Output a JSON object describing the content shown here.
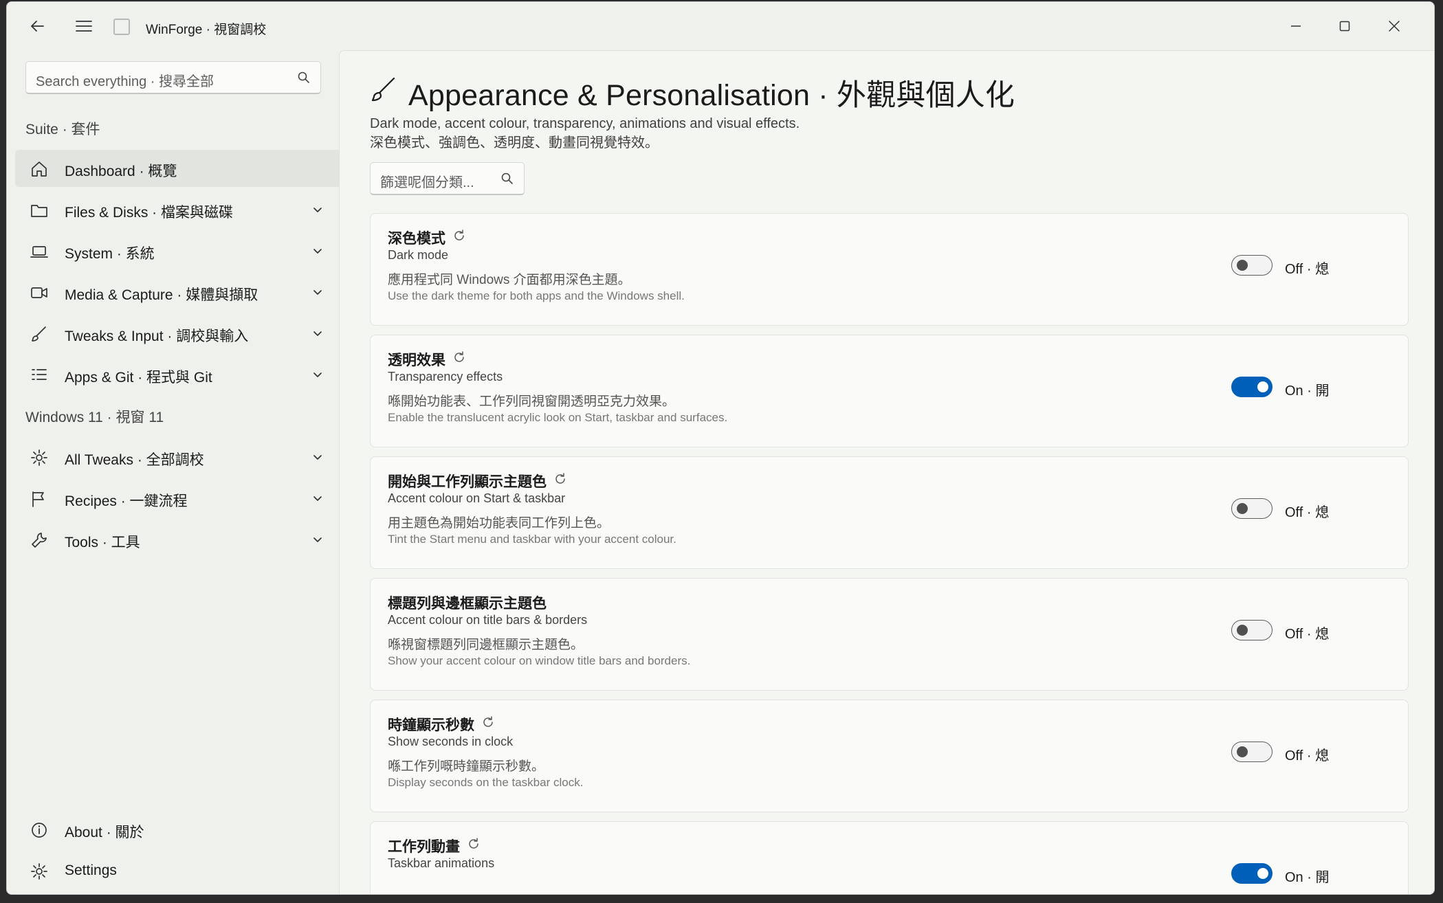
{
  "app": {
    "title": "WinForge · 視窗調校"
  },
  "sidebar": {
    "search_placeholder": "Search everything · 搜尋全部",
    "sections": {
      "suite": "Suite · 套件",
      "windows11": "Windows 11 · 視窗 11"
    },
    "items": [
      {
        "label": "Dashboard · 概覽",
        "icon": "home-icon"
      },
      {
        "label": "Files & Disks · 檔案與磁碟",
        "icon": "folder-icon"
      },
      {
        "label": "System · 系統",
        "icon": "laptop-icon"
      },
      {
        "label": "Media & Capture · 媒體與擷取",
        "icon": "camera-icon"
      },
      {
        "label": "Tweaks & Input · 調校與輸入",
        "icon": "brush-icon"
      },
      {
        "label": "Apps & Git · 程式與 Git",
        "icon": "list-icon"
      },
      {
        "label": "All Tweaks · 全部調校",
        "icon": "gear-icon"
      },
      {
        "label": "Recipes · 一鍵流程",
        "icon": "flag-icon"
      },
      {
        "label": "Tools · 工具",
        "icon": "wrench-icon"
      }
    ],
    "footer": [
      {
        "label": "About · 關於",
        "icon": "info-icon"
      },
      {
        "label": "Settings",
        "icon": "gear-icon"
      }
    ]
  },
  "page": {
    "title": "Appearance & Personalisation · 外觀與個人化",
    "desc_en": "Dark mode, accent colour, transparency, animations and visual effects.",
    "desc_zh": "深色模式、強調色、透明度、動畫同視覺特效。",
    "filter_placeholder": "篩選呢個分類..."
  },
  "settings": [
    {
      "title": "深色模式",
      "subtitle": "Dark mode",
      "desc_zh": "應用程式同 Windows 介面都用深色主題。",
      "desc_en": "Use the dark theme for both apps and the Windows shell.",
      "on": false,
      "state": "Off · 熄",
      "reset": true
    },
    {
      "title": "透明效果",
      "subtitle": "Transparency effects",
      "desc_zh": "喺開始功能表、工作列同視窗開透明亞克力效果。",
      "desc_en": "Enable the translucent acrylic look on Start, taskbar and surfaces.",
      "on": true,
      "state": "On · 開",
      "reset": true
    },
    {
      "title": "開始與工作列顯示主題色",
      "subtitle": "Accent colour on Start & taskbar",
      "desc_zh": "用主題色為開始功能表同工作列上色。",
      "desc_en": "Tint the Start menu and taskbar with your accent colour.",
      "on": false,
      "state": "Off · 熄",
      "reset": true
    },
    {
      "title": "標題列與邊框顯示主題色",
      "subtitle": "Accent colour on title bars & borders",
      "desc_zh": "喺視窗標題列同邊框顯示主題色。",
      "desc_en": "Show your accent colour on window title bars and borders.",
      "on": false,
      "state": "Off · 熄",
      "reset": false
    },
    {
      "title": "時鐘顯示秒數",
      "subtitle": "Show seconds in clock",
      "desc_zh": "喺工作列嘅時鐘顯示秒數。",
      "desc_en": "Display seconds on the taskbar clock.",
      "on": false,
      "state": "Off · 熄",
      "reset": true
    },
    {
      "title": "工作列動畫",
      "subtitle": "Taskbar animations",
      "desc_zh": "",
      "desc_en": "",
      "on": true,
      "state": "On · 開",
      "reset": true
    }
  ],
  "colors": {
    "accent": "#005fb8",
    "background": "#eef1ec",
    "card": "#fafbf9"
  }
}
